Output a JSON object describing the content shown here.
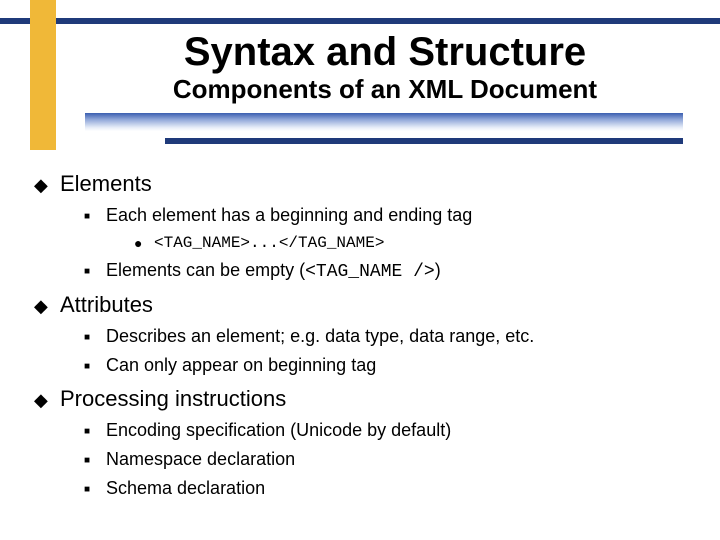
{
  "title": "Syntax and Structure",
  "subtitle": "Components of an XML Document",
  "sections": {
    "elements": {
      "label": "Elements",
      "item1": "Each element has a beginning and ending tag",
      "item1_sub": "<TAG_NAME>...</TAG_NAME>",
      "item2_pre": "Elements can be empty (",
      "item2_mono": "<TAG_NAME />",
      "item2_post": ")"
    },
    "attributes": {
      "label": "Attributes",
      "item1": "Describes an element; e.g. data type, data range, etc.",
      "item2": "Can only appear on beginning tag"
    },
    "processing": {
      "label": "Processing instructions",
      "item1": "Encoding specification (Unicode by default)",
      "item2": "Namespace declaration",
      "item3": "Schema declaration"
    }
  }
}
